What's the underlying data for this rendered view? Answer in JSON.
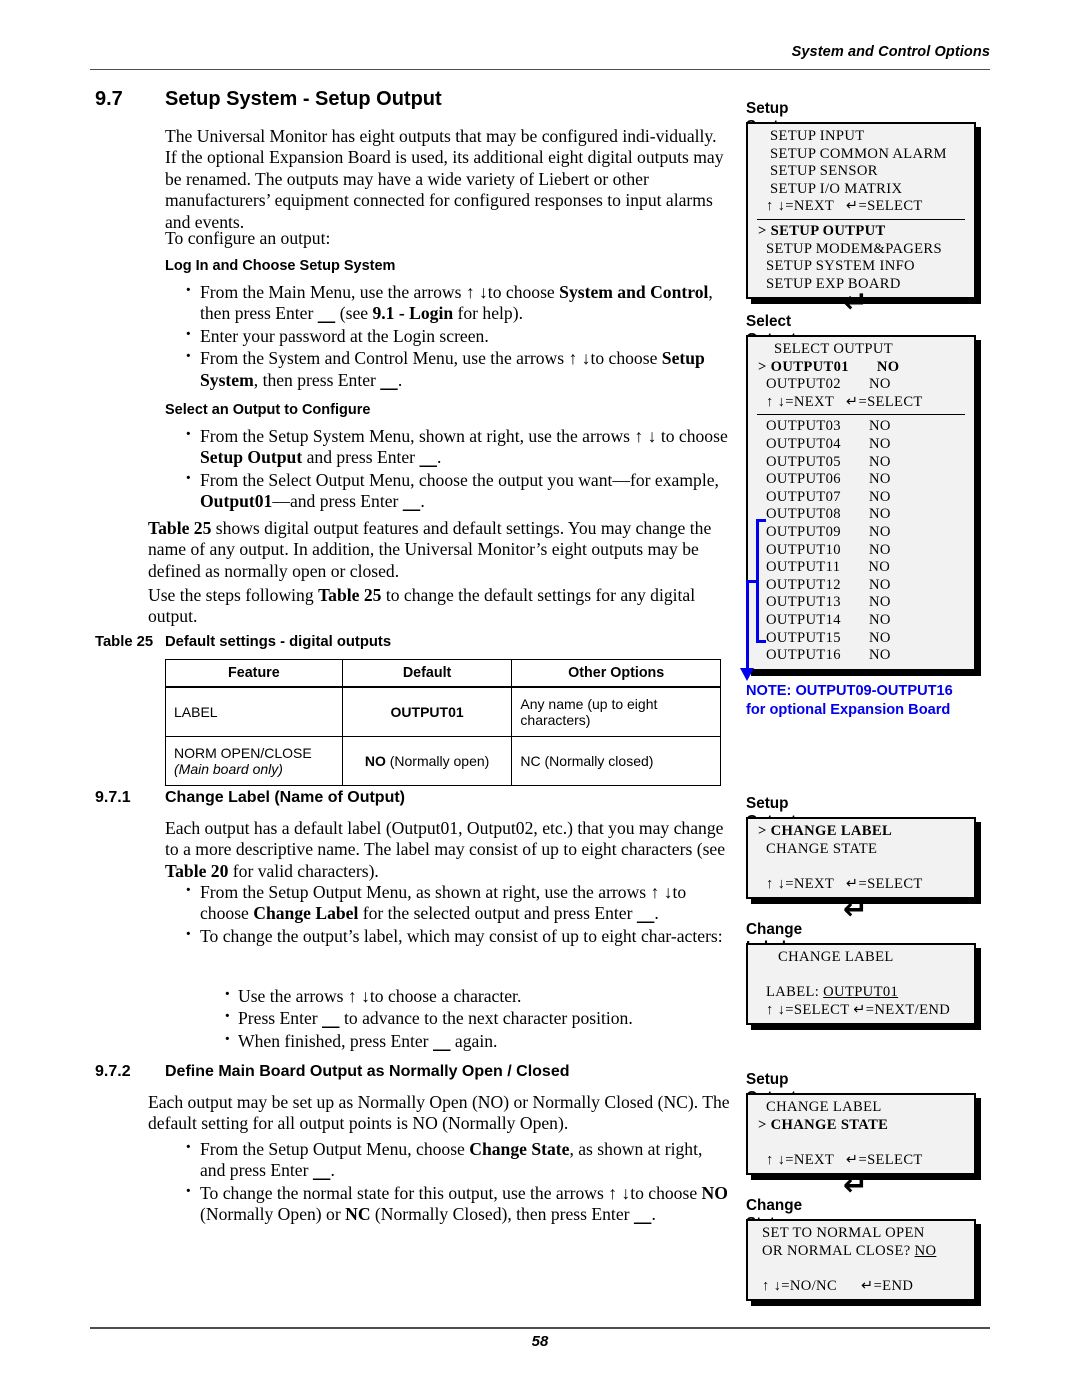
{
  "header": {
    "running_head": "System and Control Options"
  },
  "footer": {
    "page_number": "58"
  },
  "section_97": {
    "number": "9.7",
    "title": "Setup System - Setup Output",
    "intro": "The Universal Monitor has eight outputs that may be configured individually. If the optional Expansion Board is used, its additional eight digital outputs may be renamed. The outputs may have a wide variety of Liebert or other manufacturers’ equipment connected for configured responses to input alarms and events.",
    "to_configure": "To configure an output:",
    "sub1_heading": "Log In and Choose Setup System",
    "sub1_bullets": [
      "From the Main Menu, use the arrows ↑ ↓to choose System and Control, then press Enter ↵ (see 9.1 - Login for help).",
      "Enter your password at the Login screen.",
      "From the System and Control Menu, use the arrows ↑ ↓to choose Setup System, then press Enter ↵."
    ],
    "sub2_heading": "Select an Output to Configure",
    "sub2_bullets": [
      "From the Setup System Menu, shown at right, use the arrows ↑ ↓ to choose Setup Output and press Enter ↵.",
      "From the Select Output Menu, choose the output you want—for example, Output01—and press Enter ↵."
    ],
    "para_table_intro": "Table 25 shows digital output features and default settings. You may change the name of any output. In addition, the Universal Monitor’s eight outputs may be defined as normally open or closed.",
    "para_steps": "Use the steps following Table 25 to change the default settings for any digital output."
  },
  "table25": {
    "caption_label": "Table 25",
    "caption_text": "Default settings - digital outputs",
    "headers": [
      "Feature",
      "Default",
      "Other Options"
    ],
    "rows": [
      {
        "feature": "LABEL",
        "feature_sub": "",
        "default_bold": "OUTPUT01",
        "default_rest": "",
        "other": "Any name (up to eight characters)"
      },
      {
        "feature": "NORM OPEN/CLOSE",
        "feature_sub": "(Main board only)",
        "default_bold": "NO",
        "default_rest": " (Normally open)",
        "other": "NC (Normally closed)"
      }
    ]
  },
  "section_971": {
    "number": "9.7.1",
    "title": "Change Label (Name of Output)",
    "para": "Each output has a default label (Output01, Output02, etc.) that you may change to a more descriptive name. The label may consist of up to eight characters (see Table 20 for valid characters).",
    "bullets": [
      "From the Setup Output Menu, as shown at right, use the arrows ↑ ↓to choose Change Label for the selected output and press Enter ↵.",
      "To change the output’s label, which may consist of up to eight characters:"
    ],
    "subbullets": [
      "Use the arrows ↑ ↓to choose a character.",
      "Press Enter ↵ to advance to the next character position.",
      "When finished, press Enter ↵ again."
    ]
  },
  "section_972": {
    "number": "9.7.2",
    "title": "Define Main Board Output as Normally Open / Closed",
    "para": "Each output may be set up as Normally Open (NO) or Normally Closed (NC). The default setting for all output points is NO (Normally Open).",
    "bullets": [
      "From the Setup Output Menu, choose Change State, as shown at right, and press Enter ↵.",
      "To change the normal state for this output, use the arrows ↑ ↓to choose NO (Normally Open) or NC (Normally Closed), then press Enter ↵."
    ]
  },
  "lcd_panels": {
    "setup_system_menu": {
      "title": "Setup System Menu",
      "lines_above": [
        "   SETUP INPUT",
        "   SETUP COMMON ALARM",
        "   SETUP SENSOR",
        "   SETUP I/O MATRIX",
        "  ↑ ↓=NEXT   ↵=SELECT"
      ],
      "lines_below": [
        "> SETUP OUTPUT",
        "  SETUP MODEM&PAGERS",
        "  SETUP SYSTEM INFO",
        "  SETUP EXP BOARD"
      ],
      "selected_line": "> SETUP OUTPUT"
    },
    "select_output_menu": {
      "title": "Select Output Menu",
      "lines_above": [
        "    SELECT OUTPUT",
        "> OUTPUT01       NO",
        "  OUTPUT02       NO",
        "  ↑ ↓=NEXT   ↵=SELECT"
      ],
      "selected_line": "> OUTPUT01       NO",
      "lines_below": [
        "  OUTPUT03       NO",
        "  OUTPUT04       NO",
        "  OUTPUT05       NO",
        "  OUTPUT06       NO",
        "  OUTPUT07       NO",
        "  OUTPUT08       NO",
        "  OUTPUT09       NO",
        "  OUTPUT10       NO",
        "  OUTPUT11       NO",
        "  OUTPUT12       NO",
        "  OUTPUT13       NO",
        "  OUTPUT14       NO",
        "  OUTPUT15       NO",
        "  OUTPUT16       NO"
      ]
    },
    "note": "NOTE: OUTPUT09-OUTPUT16\nfor optional Expansion Board",
    "setup_output_menu_label": {
      "title": "Setup Output Menu",
      "lines": [
        "> CHANGE LABEL",
        "  CHANGE STATE",
        "",
        "  ↑ ↓=NEXT   ↵=SELECT"
      ],
      "selected_line": "> CHANGE LABEL"
    },
    "change_label": {
      "title": "Change Label",
      "line1": "     CHANGE LABEL",
      "line2": "",
      "label_prefix": "  LABEL: ",
      "label_value": "OUTPUT01",
      "line4": "  ↑ ↓=SELECT ↵=NEXT/END"
    },
    "setup_output_menu_state": {
      "title": "Setup Output Menu",
      "lines": [
        "  CHANGE LABEL",
        "> CHANGE STATE",
        "",
        "  ↑ ↓=NEXT   ↵=SELECT"
      ],
      "selected_line": "> CHANGE STATE"
    },
    "change_state": {
      "title": "Change State",
      "line1": " SET TO NORMAL OPEN",
      "line2_prefix": " OR NORMAL CLOSE? ",
      "line2_value": "NO",
      "line3": "",
      "line4": " ↑ ↓=NO/NC      ↵=END"
    },
    "enter_arrow_glyph": "↵"
  },
  "colors": {
    "note_blue": "#0000ee",
    "lcd_bg": "#f2f2f2",
    "rule": "#4d4d4d"
  }
}
